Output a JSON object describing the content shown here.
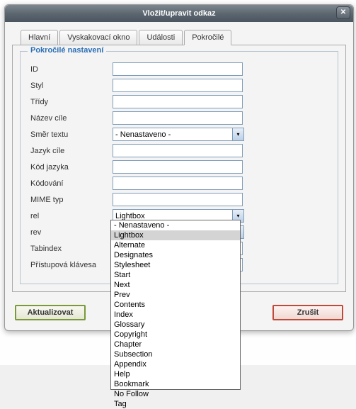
{
  "dialog": {
    "title": "Vložit/upravit odkaz"
  },
  "tabs": {
    "t0": "Hlavní",
    "t1": "Vyskakovací okno",
    "t2": "Události",
    "t3": "Pokročilé"
  },
  "fieldset": {
    "legend": "Pokročilé nastavení"
  },
  "labels": {
    "id": "ID",
    "style": "Styl",
    "classes": "Třídy",
    "target_name": "Název cíle",
    "text_dir": "Směr textu",
    "lang_target": "Jazyk cíle",
    "lang_code": "Kód jazyka",
    "encoding": "Kódování",
    "mime": "MIME typ",
    "rel": "rel",
    "rev": "rev",
    "tabindex": "Tabindex",
    "accesskey": "Přístupová klávesa"
  },
  "values": {
    "text_dir": "- Nenastaveno -",
    "rel": "Lightbox",
    "rev": ""
  },
  "rel_options": {
    "o0": "- Nenastaveno -",
    "o1": "Lightbox",
    "o2": "Alternate",
    "o3": "Designates",
    "o4": "Stylesheet",
    "o5": "Start",
    "o6": "Next",
    "o7": "Prev",
    "o8": "Contents",
    "o9": "Index",
    "o10": "Glossary",
    "o11": "Copyright",
    "o12": "Chapter",
    "o13": "Subsection",
    "o14": "Appendix",
    "o15": "Help",
    "o16": "Bookmark",
    "o17": "No Follow",
    "o18": "Tag"
  },
  "buttons": {
    "update": "Aktualizovat",
    "cancel": "Zrušit"
  }
}
